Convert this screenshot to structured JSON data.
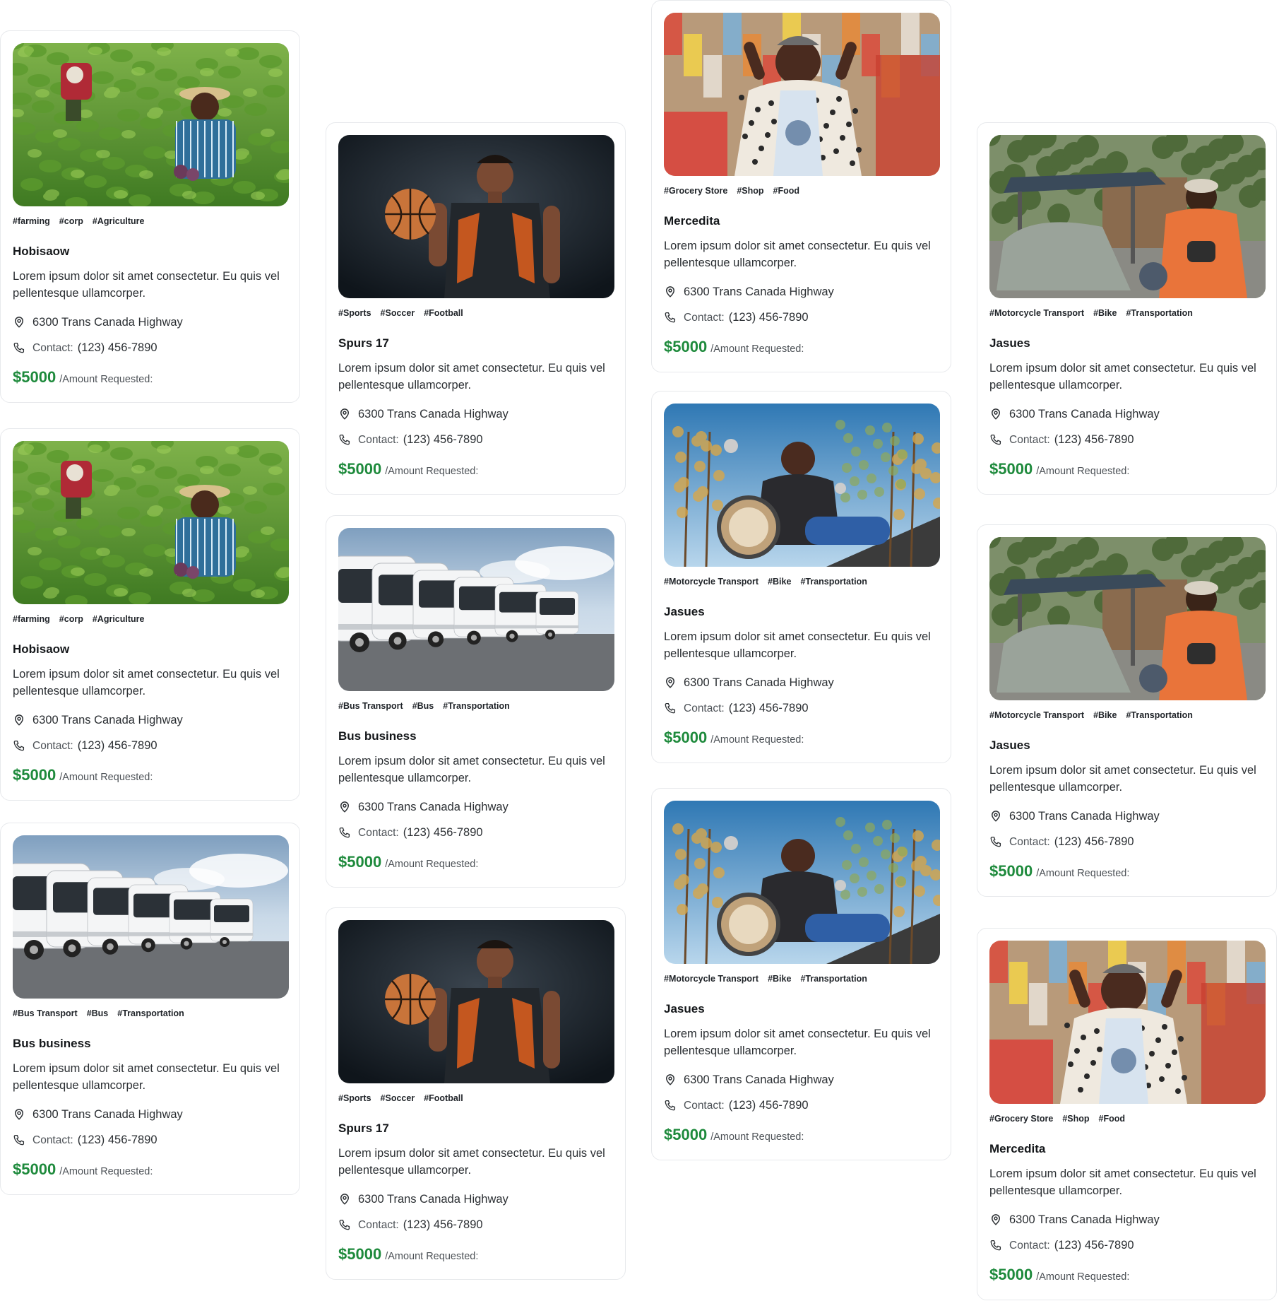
{
  "cards": [
    {
      "image": "farmers-field",
      "tags": [
        "#farming",
        "#corp",
        "#Agriculture"
      ],
      "title": "Hobisaow",
      "description": "Lorem ipsum dolor sit amet consectetur. Eu quis vel pellentesque ullamcorper.",
      "address": "6300 Trans Canada Highway",
      "contact_label": "Contact:",
      "phone": "(123) 456-7890",
      "amount": "$5000",
      "amount_label": "/Amount Requested:"
    },
    {
      "image": "farmers-field",
      "tags": [
        "#farming",
        "#corp",
        "#Agriculture"
      ],
      "title": "Hobisaow",
      "description": "Lorem ipsum dolor sit amet consectetur. Eu quis vel pellentesque ullamcorper.",
      "address": "6300 Trans Canada Highway",
      "contact_label": "Contact:",
      "phone": "(123) 456-7890",
      "amount": "$5000",
      "amount_label": "/Amount Requested:"
    },
    {
      "image": "bus-fleet",
      "tags": [
        "#Bus Transport",
        "#Bus",
        "#Transportation"
      ],
      "title": "Bus business",
      "description": "Lorem ipsum dolor sit amet consectetur. Eu quis vel pellentesque ullamcorper.",
      "address": "6300 Trans Canada Highway",
      "contact_label": "Contact:",
      "phone": "(123) 456-7890",
      "amount": "$5000",
      "amount_label": "/Amount Requested:"
    },
    {
      "image": "basketball-player",
      "tags": [
        "#Sports",
        "#Soccer",
        "#Football"
      ],
      "title": "Spurs 17",
      "description": "Lorem ipsum dolor sit amet consectetur. Eu quis vel pellentesque ullamcorper.",
      "address": "6300 Trans Canada Highway",
      "contact_label": "Contact:",
      "phone": "(123) 456-7890",
      "amount": "$5000",
      "amount_label": "/Amount Requested:"
    },
    {
      "image": "bus-fleet",
      "tags": [
        "#Bus Transport",
        "#Bus",
        "#Transportation"
      ],
      "title": "Bus business",
      "description": "Lorem ipsum dolor sit amet consectetur. Eu quis vel pellentesque ullamcorper.",
      "address": "6300 Trans Canada Highway",
      "contact_label": "Contact:",
      "phone": "(123) 456-7890",
      "amount": "$5000",
      "amount_label": "/Amount Requested:"
    },
    {
      "image": "basketball-player",
      "tags": [
        "#Sports",
        "#Soccer",
        "#Football"
      ],
      "title": "Spurs 17",
      "description": "Lorem ipsum dolor sit amet consectetur. Eu quis vel pellentesque ullamcorper.",
      "address": "6300 Trans Canada Highway",
      "contact_label": "Contact:",
      "phone": "(123) 456-7890",
      "amount": "$5000",
      "amount_label": "/Amount Requested:"
    },
    {
      "image": "grocery-vendor",
      "tags": [
        "#Grocery Store",
        "#Shop",
        "#Food"
      ],
      "title": "Mercedita",
      "description": "Lorem ipsum dolor sit amet consectetur. Eu quis vel pellentesque ullamcorper.",
      "address": "6300 Trans Canada Highway",
      "contact_label": "Contact:",
      "phone": "(123) 456-7890",
      "amount": "$5000",
      "amount_label": "/Amount Requested:"
    },
    {
      "image": "motorcycle-rider",
      "tags": [
        "#Motorcycle Transport",
        "#Bike",
        "#Transportation"
      ],
      "title": "Jasues",
      "description": "Lorem ipsum dolor sit amet consectetur. Eu quis vel pellentesque ullamcorper.",
      "address": "6300 Trans Canada Highway",
      "contact_label": "Contact:",
      "phone": "(123) 456-7890",
      "amount": "$5000",
      "amount_label": "/Amount Requested:"
    },
    {
      "image": "motorcycle-rider",
      "tags": [
        "#Motorcycle Transport",
        "#Bike",
        "#Transportation"
      ],
      "title": "Jasues",
      "description": "Lorem ipsum dolor sit amet consectetur. Eu quis vel pellentesque ullamcorper.",
      "address": "6300 Trans Canada Highway",
      "contact_label": "Contact:",
      "phone": "(123) 456-7890",
      "amount": "$5000",
      "amount_label": "/Amount Requested:"
    },
    {
      "image": "tuktuk-driver",
      "tags": [
        "#Motorcycle Transport",
        "#Bike",
        "#Transportation"
      ],
      "title": "Jasues",
      "description": "Lorem ipsum dolor sit amet consectetur. Eu quis vel pellentesque ullamcorper.",
      "address": "6300 Trans Canada Highway",
      "contact_label": "Contact:",
      "phone": "(123) 456-7890",
      "amount": "$5000",
      "amount_label": "/Amount Requested:"
    },
    {
      "image": "tuktuk-driver",
      "tags": [
        "#Motorcycle Transport",
        "#Bike",
        "#Transportation"
      ],
      "title": "Jasues",
      "description": "Lorem ipsum dolor sit amet consectetur. Eu quis vel pellentesque ullamcorper.",
      "address": "6300 Trans Canada Highway",
      "contact_label": "Contact:",
      "phone": "(123) 456-7890",
      "amount": "$5000",
      "amount_label": "/Amount Requested:"
    },
    {
      "image": "grocery-vendor",
      "tags": [
        "#Grocery Store",
        "#Shop",
        "#Food"
      ],
      "title": "Mercedita",
      "description": "Lorem ipsum dolor sit amet consectetur. Eu quis vel pellentesque ullamcorper.",
      "address": "6300 Trans Canada Highway",
      "contact_label": "Contact:",
      "phone": "(123) 456-7890",
      "amount": "$5000",
      "amount_label": "/Amount Requested:"
    }
  ],
  "colors": {
    "amount": "#1e8a3c",
    "border": "#e7e9ec"
  }
}
